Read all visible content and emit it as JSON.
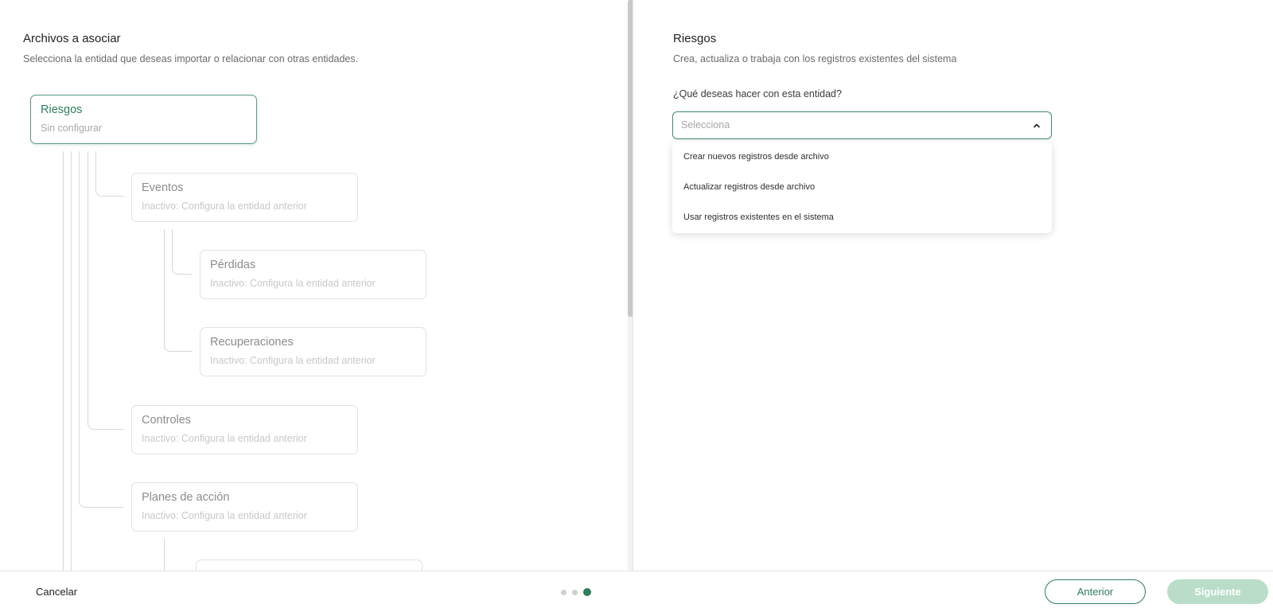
{
  "left": {
    "title": "Archivos a asociar",
    "description": "Selecciona la entidad que deseas importar o relacionar con otras entidades.",
    "tree": [
      {
        "name": "Riesgos",
        "status": "Sin configurar"
      },
      {
        "name": "Eventos",
        "status": "Inactivo: Configura la entidad anterior"
      },
      {
        "name": "Pérdidas",
        "status": "Inactivo: Configura la entidad anterior"
      },
      {
        "name": "Recuperaciones",
        "status": "Inactivo: Configura la entidad anterior"
      },
      {
        "name": "Controles",
        "status": "Inactivo: Configura la entidad anterior"
      },
      {
        "name": "Planes de acción",
        "status": "Inactivo: Configura la entidad anterior"
      }
    ]
  },
  "right": {
    "title": "Riesgos",
    "description": "Crea, actualiza o trabaja con los registros existentes del sistema",
    "question": "¿Qué deseas hacer con esta entidad?",
    "select_placeholder": "Selecciona",
    "options": [
      "Crear nuevos registros desde archivo",
      "Actualizar registros desde archivo",
      "Usar registros existentes en el sistema"
    ]
  },
  "footer": {
    "cancel_label": "Cancelar",
    "previous_label": "Anterior",
    "next_label": "Siguiente",
    "steps_total": 3,
    "current_step": 3
  },
  "colors": {
    "accent": "#2e7d5b",
    "accent_disabled": "#b9ddc9"
  }
}
